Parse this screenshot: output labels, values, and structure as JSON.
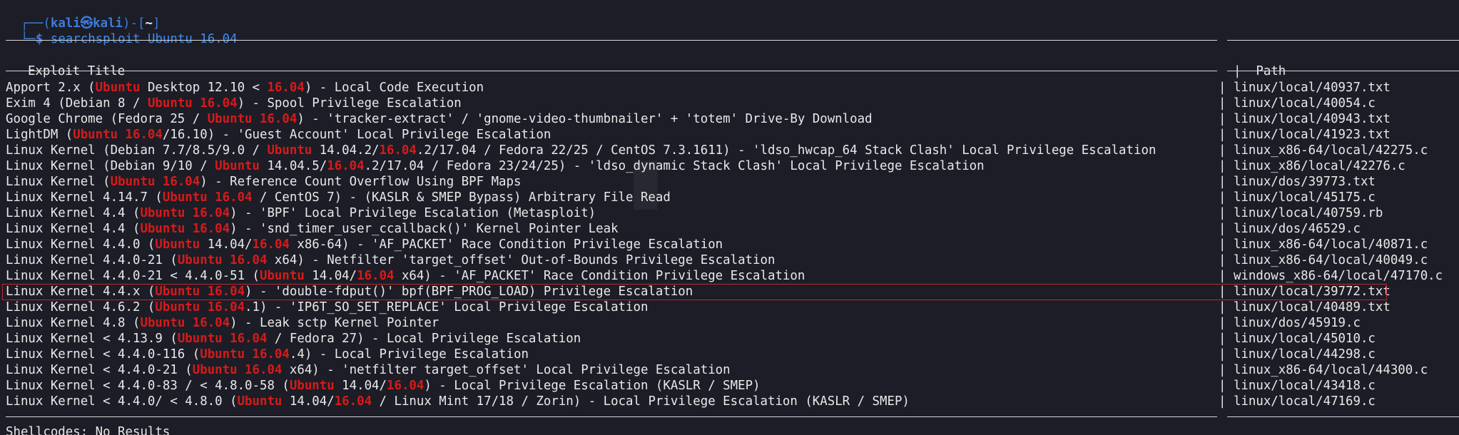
{
  "prompt": {
    "corner_top": "┌──(",
    "user": "kali",
    "at": "㉿",
    "host": "kali",
    "mid": ")-[",
    "cwd": "~",
    "end": "]",
    "corner_bottom": "└─",
    "symbol": "$",
    "command": "searchsploit Ubuntu 16.04"
  },
  "header": {
    "title_col": "Exploit Title",
    "separator": "|",
    "path_col": "Path"
  },
  "rows": [
    {
      "segments": [
        {
          "t": "Apport 2.x ("
        },
        {
          "t": "Ubuntu",
          "h": 1
        },
        {
          "t": " Desktop 12.10 < "
        },
        {
          "t": "16.04",
          "h": 1
        },
        {
          "t": ") - Local Code Execution"
        }
      ],
      "path": "linux/local/40937.txt"
    },
    {
      "segments": [
        {
          "t": "Exim 4 (Debian 8 / "
        },
        {
          "t": "Ubuntu 16.04",
          "h": 1
        },
        {
          "t": ") - Spool Privilege Escalation"
        }
      ],
      "path": "linux/local/40054.c"
    },
    {
      "segments": [
        {
          "t": "Google Chrome (Fedora 25 / "
        },
        {
          "t": "Ubuntu 16.04",
          "h": 1
        },
        {
          "t": ") - 'tracker-extract' / 'gnome-video-thumbnailer' + 'totem' Drive-By Download"
        }
      ],
      "path": "linux/local/40943.txt"
    },
    {
      "segments": [
        {
          "t": "LightDM ("
        },
        {
          "t": "Ubuntu 16.04",
          "h": 1
        },
        {
          "t": "/16.10) - 'Guest Account' Local Privilege Escalation"
        }
      ],
      "path": "linux/local/41923.txt"
    },
    {
      "segments": [
        {
          "t": "Linux Kernel (Debian 7.7/8.5/9.0 / "
        },
        {
          "t": "Ubuntu",
          "h": 1
        },
        {
          "t": " 14.04.2/"
        },
        {
          "t": "16.04",
          "h": 1
        },
        {
          "t": ".2/17.04 / Fedora 22/25 / CentOS 7.3.1611) - 'ldso_hwcap_64 Stack Clash' Local Privilege Escalation"
        }
      ],
      "path": "linux_x86-64/local/42275.c"
    },
    {
      "segments": [
        {
          "t": "Linux Kernel (Debian 9/10 / "
        },
        {
          "t": "Ubuntu",
          "h": 1
        },
        {
          "t": " 14.04.5/"
        },
        {
          "t": "16.04",
          "h": 1
        },
        {
          "t": ".2/17.04 / Fedora 23/24/25) - 'ldso_dynamic Stack Clash' Local Privilege Escalation"
        }
      ],
      "path": "linux_x86/local/42276.c"
    },
    {
      "segments": [
        {
          "t": "Linux Kernel ("
        },
        {
          "t": "Ubuntu 16.04",
          "h": 1
        },
        {
          "t": ") - Reference Count Overflow Using BPF Maps"
        }
      ],
      "path": "linux/dos/39773.txt"
    },
    {
      "segments": [
        {
          "t": "Linux Kernel 4.14.7 ("
        },
        {
          "t": "Ubuntu 16.04",
          "h": 1
        },
        {
          "t": " / CentOS 7) - (KASLR & SMEP Bypass) Arbitrary File Read"
        }
      ],
      "path": "linux/local/45175.c"
    },
    {
      "segments": [
        {
          "t": "Linux Kernel 4.4 ("
        },
        {
          "t": "Ubuntu 16.04",
          "h": 1
        },
        {
          "t": ") - 'BPF' Local Privilege Escalation (Metasploit)"
        }
      ],
      "path": "linux/local/40759.rb"
    },
    {
      "segments": [
        {
          "t": "Linux Kernel 4.4 ("
        },
        {
          "t": "Ubuntu 16.04",
          "h": 1
        },
        {
          "t": ") - 'snd_timer_user_ccallback()' Kernel Pointer Leak"
        }
      ],
      "path": "linux/dos/46529.c"
    },
    {
      "segments": [
        {
          "t": "Linux Kernel 4.4.0 ("
        },
        {
          "t": "Ubuntu",
          "h": 1
        },
        {
          "t": " 14.04/"
        },
        {
          "t": "16.04",
          "h": 1
        },
        {
          "t": " x86-64) - 'AF_PACKET' Race Condition Privilege Escalation"
        }
      ],
      "path": "linux_x86-64/local/40871.c"
    },
    {
      "segments": [
        {
          "t": "Linux Kernel 4.4.0-21 ("
        },
        {
          "t": "Ubuntu 16.04",
          "h": 1
        },
        {
          "t": " x64) - Netfilter 'target_offset' Out-of-Bounds Privilege Escalation"
        }
      ],
      "path": "linux_x86-64/local/40049.c"
    },
    {
      "segments": [
        {
          "t": "Linux Kernel 4.4.0-21 < 4.4.0-51 ("
        },
        {
          "t": "Ubuntu",
          "h": 1
        },
        {
          "t": " 14.04/"
        },
        {
          "t": "16.04",
          "h": 1
        },
        {
          "t": " x64) - 'AF_PACKET' Race Condition Privilege Escalation"
        }
      ],
      "path": "windows_x86-64/local/47170.c"
    },
    {
      "segments": [
        {
          "t": "Linux Kernel 4.4.x ("
        },
        {
          "t": "Ubuntu 16.04",
          "h": 1
        },
        {
          "t": ") - 'double-fdput()' bpf(BPF_PROG_LOAD) Privilege Escalation"
        }
      ],
      "path": "linux/local/39772.txt",
      "selected": true
    },
    {
      "segments": [
        {
          "t": "Linux Kernel 4.6.2 ("
        },
        {
          "t": "Ubuntu 16.04",
          "h": 1
        },
        {
          "t": ".1) - 'IP6T_SO_SET_REPLACE' Local Privilege Escalation"
        }
      ],
      "path": "linux/local/40489.txt"
    },
    {
      "segments": [
        {
          "t": "Linux Kernel 4.8 ("
        },
        {
          "t": "Ubuntu 16.04",
          "h": 1
        },
        {
          "t": ") - Leak sctp Kernel Pointer"
        }
      ],
      "path": "linux/dos/45919.c"
    },
    {
      "segments": [
        {
          "t": "Linux Kernel < 4.13.9 ("
        },
        {
          "t": "Ubuntu 16.04",
          "h": 1
        },
        {
          "t": " / Fedora 27) - Local Privilege Escalation"
        }
      ],
      "path": "linux/local/45010.c"
    },
    {
      "segments": [
        {
          "t": "Linux Kernel < 4.4.0-116 ("
        },
        {
          "t": "Ubuntu 16.04",
          "h": 1
        },
        {
          "t": ".4) - Local Privilege Escalation"
        }
      ],
      "path": "linux/local/44298.c"
    },
    {
      "segments": [
        {
          "t": "Linux Kernel < 4.4.0-21 ("
        },
        {
          "t": "Ubuntu 16.04",
          "h": 1
        },
        {
          "t": " x64) - 'netfilter target_offset' Local Privilege Escalation"
        }
      ],
      "path": "linux_x86-64/local/44300.c"
    },
    {
      "segments": [
        {
          "t": "Linux Kernel < 4.4.0-83 / < 4.8.0-58 ("
        },
        {
          "t": "Ubuntu",
          "h": 1
        },
        {
          "t": " 14.04/"
        },
        {
          "t": "16.04",
          "h": 1
        },
        {
          "t": ") - Local Privilege Escalation (KASLR / SMEP)"
        }
      ],
      "path": "linux/local/43418.c"
    },
    {
      "segments": [
        {
          "t": "Linux Kernel < 4.4.0/ < 4.8.0 ("
        },
        {
          "t": "Ubuntu",
          "h": 1
        },
        {
          "t": " 14.04/"
        },
        {
          "t": "16.04",
          "h": 1
        },
        {
          "t": " / Linux Mint 17/18 / Zorin) - Local Privilege Escalation (KASLR / SMEP)"
        }
      ],
      "path": "linux/local/47169.c"
    }
  ],
  "footer": {
    "shellcodes": "Shellcodes: No Results"
  }
}
